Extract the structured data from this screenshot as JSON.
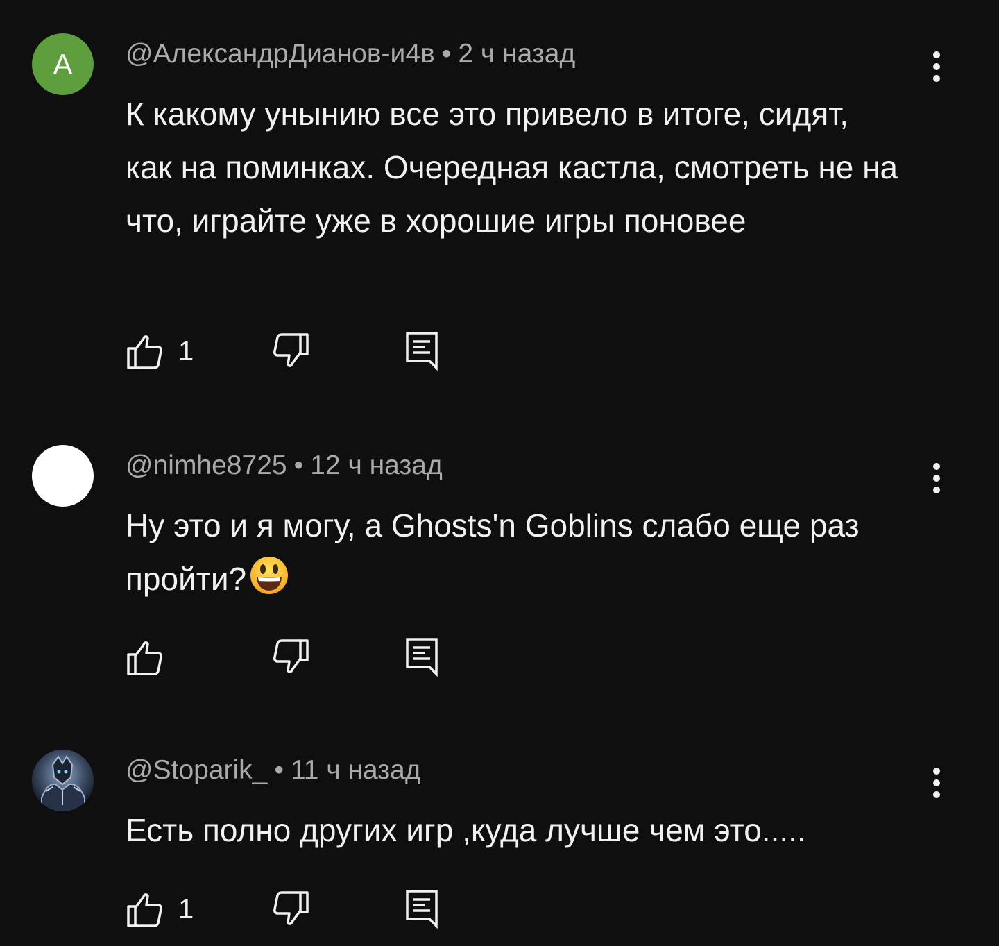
{
  "colors": {
    "background": "#0f0f0f",
    "text_primary": "#f1f1f1",
    "text_secondary": "#aaaaaa",
    "avatar_green": "#5e9e3c"
  },
  "comments": [
    {
      "author": "@АлександрДианов-и4в",
      "separator": "•",
      "time": "2 ч назад",
      "avatar_letter": "А",
      "avatar_color": "#5e9e3c",
      "text": "К какому унынию все это привело в итоге, сидят, как на поминках. Очередная кастла, смотреть не на что, играйте уже в хорошие игры поновее",
      "likes": "1"
    },
    {
      "author": "@nimhe8725",
      "separator": "•",
      "time": "12 ч назад",
      "avatar_color": "#ffffff",
      "text": "Ну это и я могу, а Ghosts'n Goblins слабо еще раз пройти?",
      "emoji": "smiling-face-emoji",
      "likes": ""
    },
    {
      "author": "@Stoparik_",
      "separator": "•",
      "time": "11 ч назад",
      "avatar_image": "armored-knight-avatar",
      "text": "Есть полно других игр ,куда лучше чем это.....",
      "likes": "1"
    }
  ],
  "icons": {
    "like": "thumb-up-icon",
    "dislike": "thumb-down-icon",
    "reply": "reply-comment-icon",
    "more": "more-vertical-icon"
  }
}
